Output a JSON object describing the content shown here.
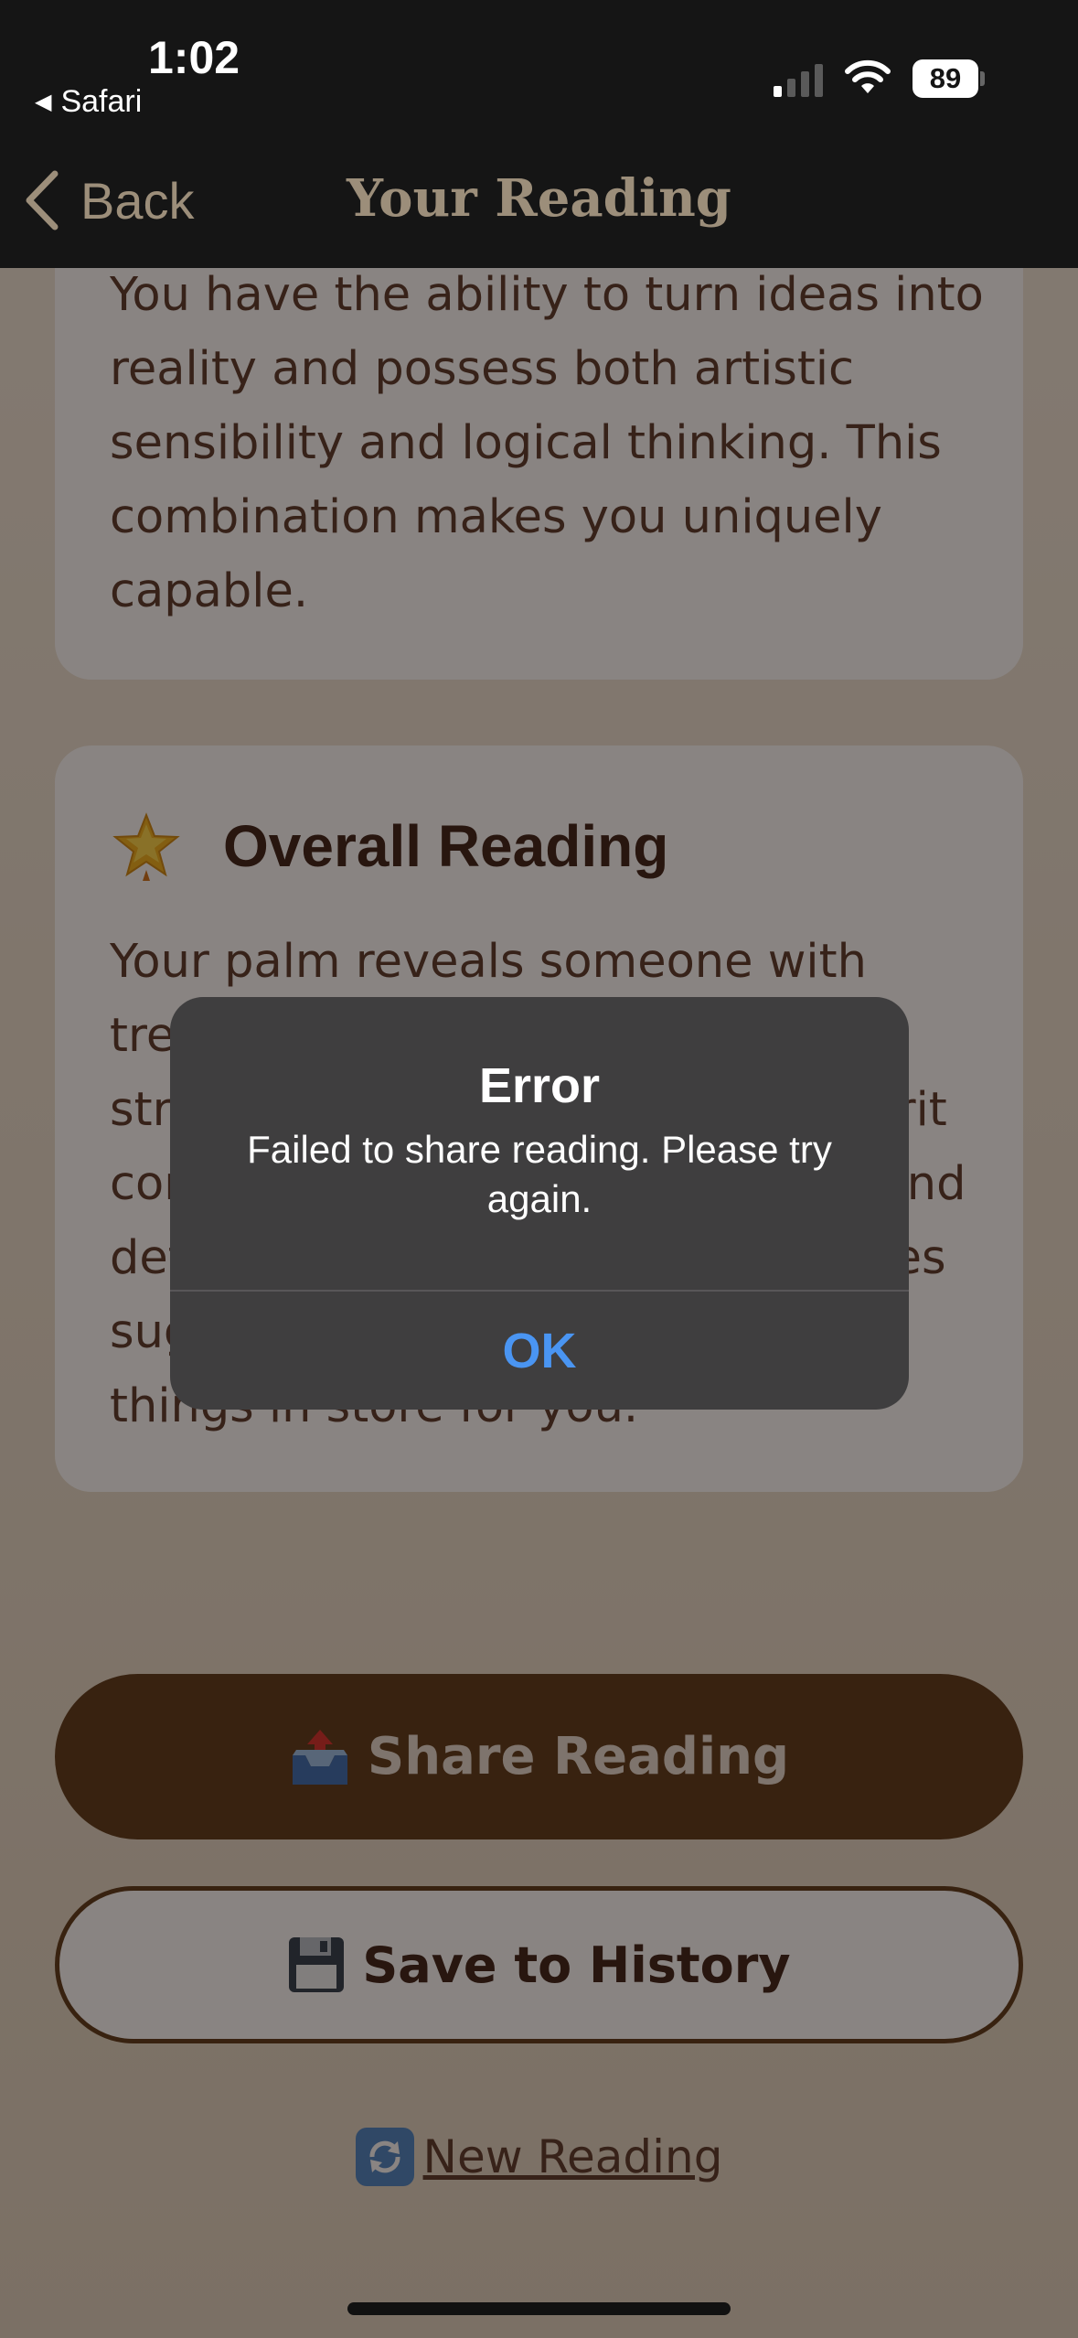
{
  "status_bar": {
    "time": "1:02",
    "back_app": "Safari",
    "battery": "89"
  },
  "nav": {
    "back_label": "Back",
    "title": "Your Reading"
  },
  "cards": [
    {
      "body": "You have the ability to turn ideas into reality and possess both artistic sensibility and logical thinking. This combination makes you uniquely capable."
    },
    {
      "icon": "star-icon",
      "title": "Overall Reading",
      "body": "Your palm reveals someone with tremendous potential. You have strong intuition and a creative spirit combined with practical wisdom and determination. Your natural abilities suggest that life has wonderful things in store for you."
    }
  ],
  "actions": {
    "share_label": "Share Reading",
    "share_icon": "outbox-tray-icon",
    "save_label": "Save to History",
    "save_icon": "floppy-disk-icon",
    "new_reading_label": "New Reading",
    "new_reading_icon": "refresh-icon"
  },
  "alert": {
    "title": "Error",
    "message": "Failed to share reading. Please try again.",
    "ok_label": "OK"
  },
  "colors": {
    "accent_brown": "#5c3a1a",
    "alert_button": "#4a95f2",
    "nav_text": "#9c8e7a"
  }
}
